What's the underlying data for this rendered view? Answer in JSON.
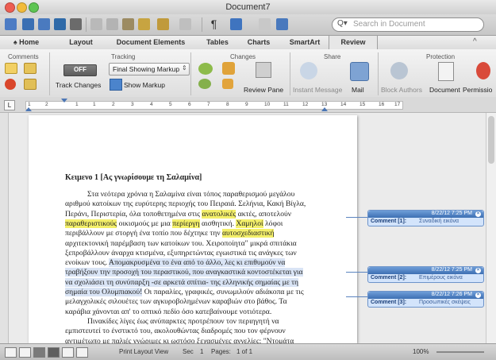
{
  "window": {
    "title": "Document7"
  },
  "toolbar": {
    "search_placeholder": "Search in Document",
    "search_icon_label": "Q▾"
  },
  "tabs": [
    "Home",
    "Layout",
    "Document Elements",
    "Tables",
    "Charts",
    "SmartArt",
    "Review"
  ],
  "active_tab": "Review",
  "ribbon": {
    "groups": {
      "comments": "Comments",
      "tracking": "Tracking",
      "changes": "Changes",
      "share": "Share",
      "protection": "Protection"
    },
    "tracking": {
      "off_label": "OFF",
      "markup_select": "Final Showing Markup",
      "track_changes": "Track Changes",
      "show_markup": "Show Markup"
    },
    "changes": {
      "review_pane": "Review Pane"
    },
    "share": {
      "instant_message": "Instant Message",
      "mail": "Mail"
    },
    "protection": {
      "block_authors": "Block Authors",
      "document": "Document",
      "permissions": "Permissio"
    }
  },
  "ruler": {
    "numbers": [
      "1",
      "2",
      "1",
      "1",
      "2",
      "3",
      "4",
      "5",
      "6",
      "7",
      "8",
      "9",
      "10",
      "11",
      "12",
      "13",
      "14",
      "15",
      "16",
      "17"
    ]
  },
  "document": {
    "heading": "Κειμενο 1 [Ας γνωρίσουμε τη Σαλαμίνα]",
    "lines": [
      {
        "text": "Στα νεότερα χρόνια η Σαλαμίνα είναι τόπος παραθερισμού μεγάλου",
        "indent": true
      },
      {
        "text": "αριθμού κατοίκων της ευρύτερης περιοχής του Πειραιά. Σελήνια, Κακή Βίγλα,",
        "indent": false
      },
      {
        "before": "Περάνι, Περιστερία, όλα τοποθετημένα στις ",
        "hl": "ανατολικές",
        "after": " ακτές, αποτελούν"
      },
      {
        "before": "",
        "hl": "παραθεριστικούς",
        "after": " οικισμούς με μια ",
        "hl2": "περίεργη",
        "after2": " αισθητική. ",
        "hl3": "Χαμηλοί",
        "after3": " λόφοι"
      },
      {
        "before": "περιβάλλουν με στοργή ένα τοπίο που δέχτηκε την ",
        "hl": "αυτοσχεδιαστική",
        "after": ""
      },
      {
        "text": "αρχιτεκτονική παρέμβαση των κατοίκων του. Χειροποίητα\" μικρά σπιτάκια",
        "indent": false
      },
      {
        "text": "ξεπροβάλλουν άναρχα κτισμένα, εξυπηρετώντας εγωιστικά τις ανάγκες των",
        "indent": false
      },
      {
        "before": "ενοίκων τους. ",
        "sel": "Απομακρυσμένα το ένα από το άλλο, λες κι επιθυμούν να",
        "after": ""
      },
      {
        "sel": "τραβήξουν την προσοχή του περαστικού, που αναγκαστικά κοντοστέκεται για",
        "before": "",
        "after": ""
      },
      {
        "sel": "να σχολιάσει τη συνύπαρξη -σε αρκετά σπίτια- της ελληνικής σημαίας με τη",
        "before": "",
        "after": ""
      },
      {
        "before": "",
        "sel": "σημαία του Ολυμπιακού!",
        "after": " Οι παραλίες, γραφικές, συνωμιλούν αδιάκοπα με τις"
      },
      {
        "text": "μελαγχολικές σιλουέτες των αγκυροβολημένων καραβιών στο βάθος. Τα",
        "indent": false
      },
      {
        "text": "καράβια χάνονται απ' το οπτικό πεδίο όσο κατεβαίνουμε νοτιότερα.",
        "indent": false
      },
      {
        "text": "Πινακίδες λίγες έως ανύπαρκτες προτρέπουν τον περιηγητή να",
        "indent": true
      },
      {
        "text": "εμπιστευτεί το ένστικτό του, ακολουθώντας διαδρομές που τον φέρνουν",
        "indent": false
      },
      {
        "text": "αντιμέτωπο με παλιές γνώριμες κι ωστόσο ξεχασμένες αγγελίες: \"Ντομάτα",
        "indent": false
      }
    ]
  },
  "comments": [
    {
      "date": "8/22/12 7:25 PM",
      "label": "Comment [1]:",
      "text": "Συναδική εικόνα"
    },
    {
      "date": "8/22/12 7:25 PM",
      "label": "Comment [2]:",
      "text": "Επιμέρους εικόνα"
    },
    {
      "date": "8/22/12 7:26 PM",
      "label": "Comment [3]:",
      "text": "Προσωπικές σκέψεις"
    }
  ],
  "status": {
    "view": "Print Layout View",
    "sec": "Sec",
    "sec_num": "1",
    "pages": "Pages:",
    "pages_val": "1 of 1",
    "zoom": "100%"
  },
  "colors": {
    "highlight": "#f4f06a",
    "comment_blue": "#3d6fb3"
  }
}
